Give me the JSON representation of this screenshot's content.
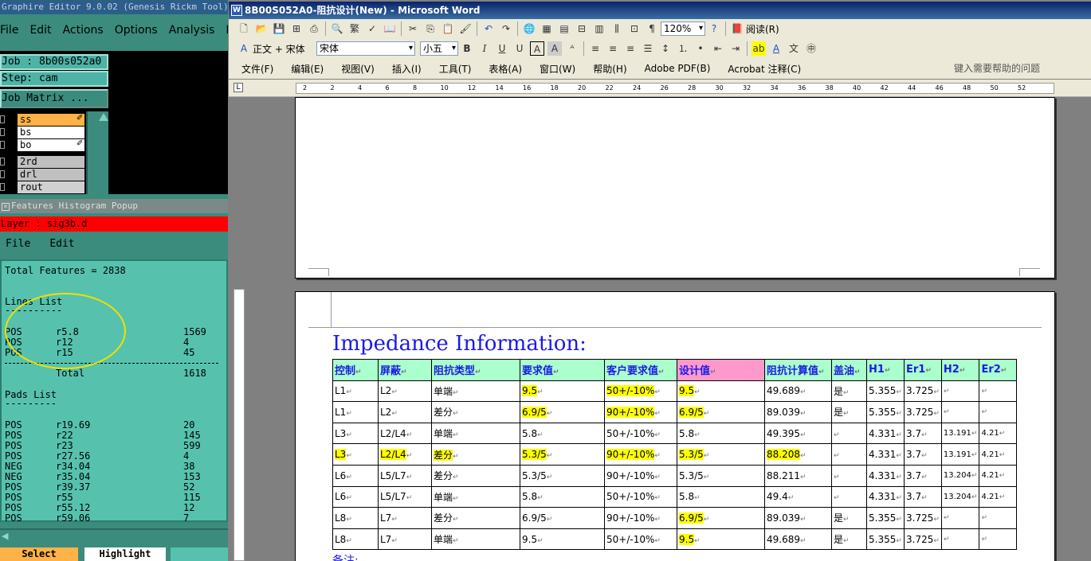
{
  "left_app": {
    "title": "Graphire Editor 9.0.02 (Genesis Rickm Tool)",
    "menu": [
      "File",
      "Edit",
      "Actions",
      "Options",
      "Analysis",
      "I"
    ],
    "job_field": "Job : 8b00s052a0",
    "step_field": "Step: cam",
    "matrix_button": "Job Matrix ...",
    "layers": [
      {
        "name": "ss",
        "color": "#ffb347",
        "mark": "✐"
      },
      {
        "name": "bs",
        "color": "#ffffff",
        "mark": ""
      },
      {
        "name": "bo",
        "color": "#ffffff",
        "mark": "✐"
      },
      {
        "name": "2rd",
        "color": "#c0c0c0",
        "mark": ""
      },
      {
        "name": "drl",
        "color": "#c0c0c0",
        "mark": ""
      },
      {
        "name": "rout",
        "color": "#d0d0d0",
        "mark": ""
      }
    ],
    "histogram": {
      "popup_title": "Features Histogram Popup",
      "layer_label": "Layer : sig3b.d",
      "menu": [
        "File",
        "Edit"
      ],
      "total_features": "Total Features = 2838",
      "lines_header": "Lines List",
      "lines_rule": "----------",
      "lines": [
        {
          "pol": "POS",
          "sym": "r5.8",
          "count": "1569"
        },
        {
          "pol": "POS",
          "sym": "r12",
          "count": "4"
        },
        {
          "pol": "POS",
          "sym": "r15",
          "count": "45"
        }
      ],
      "lines_total_label": "Total",
      "lines_total": "1618",
      "pads_header": "Pads List",
      "pads_rule": "---------",
      "pads": [
        {
          "pol": "POS",
          "sym": "r19.69",
          "count": "20"
        },
        {
          "pol": "POS",
          "sym": "r22",
          "count": "145"
        },
        {
          "pol": "POS",
          "sym": "r23",
          "count": "599"
        },
        {
          "pol": "POS",
          "sym": "r27.56",
          "count": "4"
        },
        {
          "pol": "NEG",
          "sym": "r34.04",
          "count": "38"
        },
        {
          "pol": "NEG",
          "sym": "r35.04",
          "count": "153"
        },
        {
          "pol": "POS",
          "sym": "r39.37",
          "count": "52"
        },
        {
          "pol": "POS",
          "sym": "r55",
          "count": "115"
        },
        {
          "pol": "POS",
          "sym": "r55.12",
          "count": "12"
        },
        {
          "pol": "POS",
          "sym": "r59.06",
          "count": "7"
        }
      ],
      "buttons": [
        "Select",
        "Highlight"
      ]
    }
  },
  "word": {
    "title": "8B00S052A0-阻抗设计(New) - Microsoft Word",
    "zoom": "120%",
    "read_button": "阅读(R)",
    "style_combo": "正文 + 宋体",
    "font_combo": "宋体",
    "size_combo": "小五",
    "menu": [
      "文件(F)",
      "编辑(E)",
      "视图(V)",
      "插入(I)",
      "工具(T)",
      "表格(A)",
      "窗口(W)",
      "帮助(H)",
      "Adobe PDF(B)",
      "Acrobat 注释(C)"
    ],
    "help_placeholder": "键入需要帮助的问题",
    "ruler_marks": [
      "2",
      "2",
      "4",
      "6",
      "8",
      "10",
      "12",
      "14",
      "16",
      "18",
      "20",
      "22",
      "24",
      "26",
      "28",
      "30",
      "32",
      "34",
      "36",
      "38",
      "40",
      "42",
      "44",
      "46",
      "48",
      "50",
      "52"
    ],
    "heading": "Impedance Information:",
    "table": {
      "headers": [
        "控制",
        "屏蔽",
        "阻抗类型",
        "要求值",
        "客户要求值",
        "设计值",
        "阻抗计算值",
        "盖油",
        "H1",
        "Er1",
        "H2",
        "Er2"
      ],
      "rows": [
        [
          "L1",
          "L2",
          "单端",
          "9.5",
          "50+/-10%",
          "9.5",
          "49.689",
          "是",
          "5.355",
          "3.725",
          "",
          ""
        ],
        [
          "L1",
          "L2",
          "差分",
          "6.9/5",
          "90+/-10%",
          "6.9/5",
          "89.039",
          "是",
          "5.355",
          "3.725",
          "",
          ""
        ],
        [
          "L3",
          "L2/L4",
          "单端",
          "5.8",
          "50+/-10%",
          "5.8",
          "49.395",
          "",
          "4.331",
          "3.7",
          "13.191",
          "4.21"
        ],
        [
          "L3",
          "L2/L4",
          "差分",
          "5.3/5",
          "90+/-10%",
          "5.3/5",
          "88.208",
          "",
          "4.331",
          "3.7",
          "13.191",
          "4.21"
        ],
        [
          "L6",
          "L5/L7",
          "差分",
          "5.3/5",
          "90+/-10%",
          "5.3/5",
          "88.211",
          "",
          "4.331",
          "3.7",
          "13.204",
          "4.21"
        ],
        [
          "L6",
          "L5/L7",
          "单端",
          "5.8",
          "50+/-10%",
          "5.8",
          "49.4",
          "",
          "4.331",
          "3.7",
          "13.204",
          "4.21"
        ],
        [
          "L8",
          "L7",
          "差分",
          "6.9/5",
          "90+/-10%",
          "6.9/5",
          "89.039",
          "是",
          "5.355",
          "3.725",
          "",
          ""
        ],
        [
          "L8",
          "L7",
          "单端",
          "9.5",
          "50+/-10%",
          "9.5",
          "49.689",
          "是",
          "5.355",
          "3.725",
          "",
          ""
        ]
      ],
      "paragraph_mark": "↵"
    },
    "note": "备注:"
  },
  "colors": {
    "highlight_yellow": "#ffff00",
    "header_green": "#aaffcc",
    "header_pink": "#ff99cc",
    "heading_blue": "#1a1ae6",
    "genesis_teal": "#56c2ae"
  }
}
